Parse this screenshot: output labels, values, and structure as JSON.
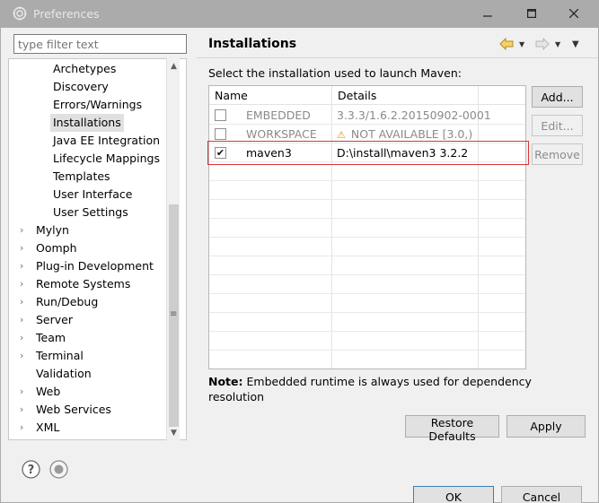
{
  "window": {
    "title": "Preferences"
  },
  "filter": {
    "placeholder": "type filter text"
  },
  "tree": {
    "children": [
      {
        "label": "Archetypes"
      },
      {
        "label": "Discovery"
      },
      {
        "label": "Errors/Warnings"
      },
      {
        "label": "Installations",
        "selected": true
      },
      {
        "label": "Java EE Integration"
      },
      {
        "label": "Lifecycle Mappings"
      },
      {
        "label": "Templates"
      },
      {
        "label": "User Interface"
      },
      {
        "label": "User Settings"
      }
    ],
    "roots": [
      {
        "label": "Mylyn",
        "expandable": true
      },
      {
        "label": "Oomph",
        "expandable": true
      },
      {
        "label": "Plug-in Development",
        "expandable": true
      },
      {
        "label": "Remote Systems",
        "expandable": true
      },
      {
        "label": "Run/Debug",
        "expandable": true
      },
      {
        "label": "Server",
        "expandable": true
      },
      {
        "label": "Team",
        "expandable": true
      },
      {
        "label": "Terminal",
        "expandable": true
      },
      {
        "label": "Validation",
        "expandable": false
      },
      {
        "label": "Web",
        "expandable": true
      },
      {
        "label": "Web Services",
        "expandable": true
      },
      {
        "label": "XML",
        "expandable": true
      }
    ]
  },
  "page": {
    "title": "Installations",
    "description": "Select the installation used to launch Maven:",
    "note_bold": "Note:",
    "note_text": " Embedded runtime is always used for dependency resolution"
  },
  "table": {
    "headers": {
      "name": "Name",
      "details": "Details"
    },
    "rows": [
      {
        "name": "EMBEDDED",
        "details": "3.3.3/1.6.2.20150902-0001",
        "checked": false,
        "dim": true,
        "warning": false
      },
      {
        "name": "WORKSPACE",
        "details": "NOT AVAILABLE [3.0,)",
        "checked": false,
        "dim": true,
        "warning": true
      },
      {
        "name": "maven3",
        "details": "D:\\install\\maven3 3.2.2",
        "checked": true,
        "dim": false,
        "warning": false
      }
    ]
  },
  "buttons": {
    "add": "Add...",
    "edit": "Edit...",
    "remove": "Remove",
    "restore_defaults": "Restore Defaults",
    "apply": "Apply",
    "ok": "OK",
    "cancel": "Cancel"
  },
  "colors": {
    "highlight": "#dd3333",
    "selection": "#e0e0e0",
    "warning": "#d99a00"
  }
}
